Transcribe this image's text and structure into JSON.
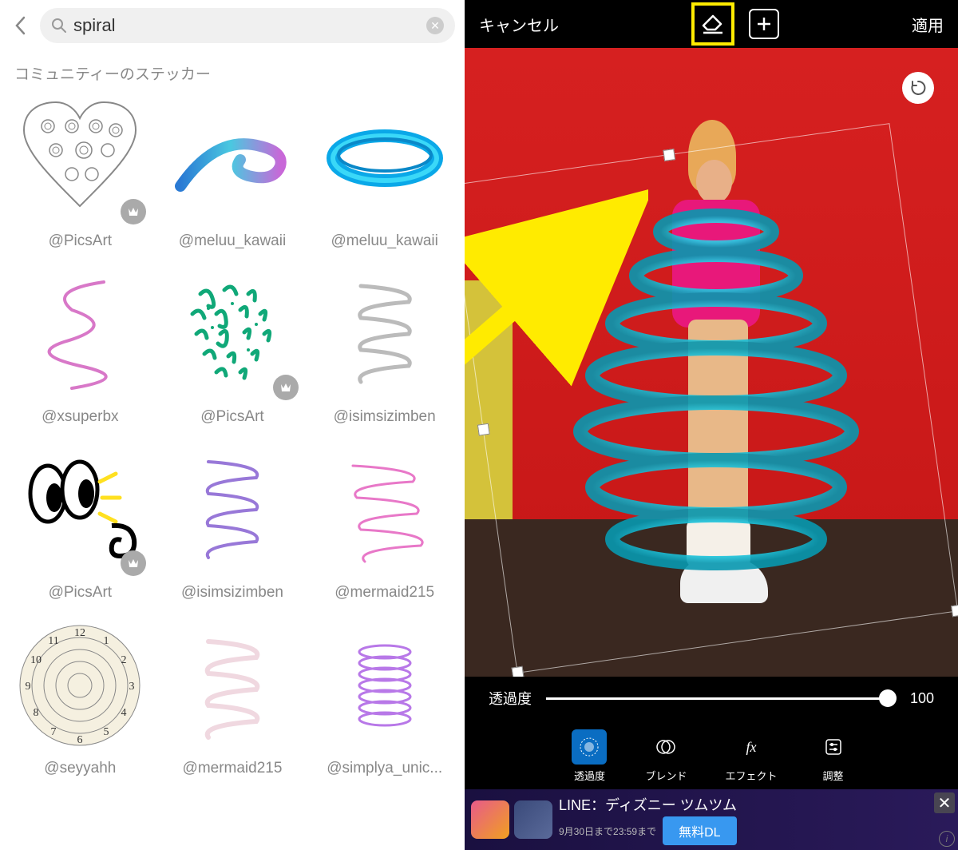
{
  "left": {
    "search": {
      "value": "spiral",
      "placeholder": ""
    },
    "section_title": "コミュニティーのステッカー",
    "stickers": [
      {
        "label": "@PicsArt",
        "type": "heart",
        "premium": true
      },
      {
        "label": "@meluu_kawaii",
        "type": "swirl",
        "premium": false
      },
      {
        "label": "@meluu_kawaii",
        "type": "ring",
        "premium": false
      },
      {
        "label": "@xsuperbx",
        "type": "squiggle",
        "premium": false
      },
      {
        "label": "@PicsArt",
        "type": "doodle",
        "premium": true
      },
      {
        "label": "@isimsizimben",
        "type": "coil",
        "premium": false
      },
      {
        "label": "@PicsArt",
        "type": "eyes",
        "premium": true
      },
      {
        "label": "@isimsizimben",
        "type": "coil2",
        "premium": false
      },
      {
        "label": "@mermaid215",
        "type": "coil3",
        "premium": false
      },
      {
        "label": "@seyyahh",
        "type": "clock",
        "premium": false
      },
      {
        "label": "@mermaid215",
        "type": "coil4",
        "premium": false
      },
      {
        "label": "@simplya_unic...",
        "type": "coil5",
        "premium": false
      }
    ]
  },
  "right": {
    "header": {
      "cancel": "キャンセル",
      "apply": "適用"
    },
    "slider": {
      "label": "透過度",
      "value": "100"
    },
    "tools": [
      {
        "key": "opacity",
        "label": "透過度",
        "active": true
      },
      {
        "key": "blend",
        "label": "ブレンド",
        "active": false
      },
      {
        "key": "effect",
        "label": "エフェクト",
        "active": false
      },
      {
        "key": "adjust",
        "label": "調整",
        "active": false
      }
    ],
    "ad": {
      "title": "LINE：ディズニー ツムツム",
      "subtitle": "9月30日まで23:59まで",
      "button": "無料DL"
    }
  }
}
